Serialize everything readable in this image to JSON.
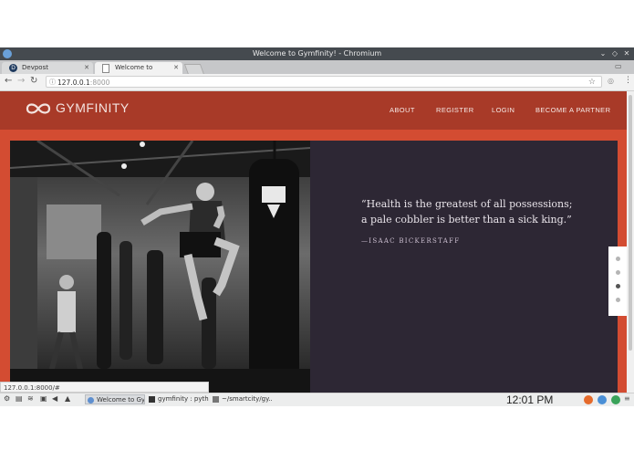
{
  "window": {
    "title": "Welcome to Gymfinity! - Chromium"
  },
  "tabs": [
    {
      "label": "Devpost"
    },
    {
      "label": "Welcome to Gymfinity!"
    }
  ],
  "address_bar": {
    "host": "127.0.0.1",
    "port": ":8000"
  },
  "site": {
    "brand": "GYMFINITY",
    "nav": [
      "ABOUT",
      "REGISTER",
      "LOGIN",
      "BECOME A PARTNER"
    ],
    "quote": "“Health is the greatest of all possessions; a pale cobbler is better than a sick king.”",
    "author": "—ISAAC BICKERSTAFF",
    "slider": {
      "count": 4,
      "active_index": 2
    }
  },
  "status_url": "127.0.0.1:8000/#",
  "taskbar": {
    "tasks": [
      "Welcome to Gy...",
      "gymfinity : pyth...",
      "~/smartcity/gy..."
    ],
    "clock": "12:01 PM"
  },
  "colors": {
    "brand_red": "#d34c32",
    "header_red": "#a83a28",
    "quote_panel": "#2d2734"
  }
}
